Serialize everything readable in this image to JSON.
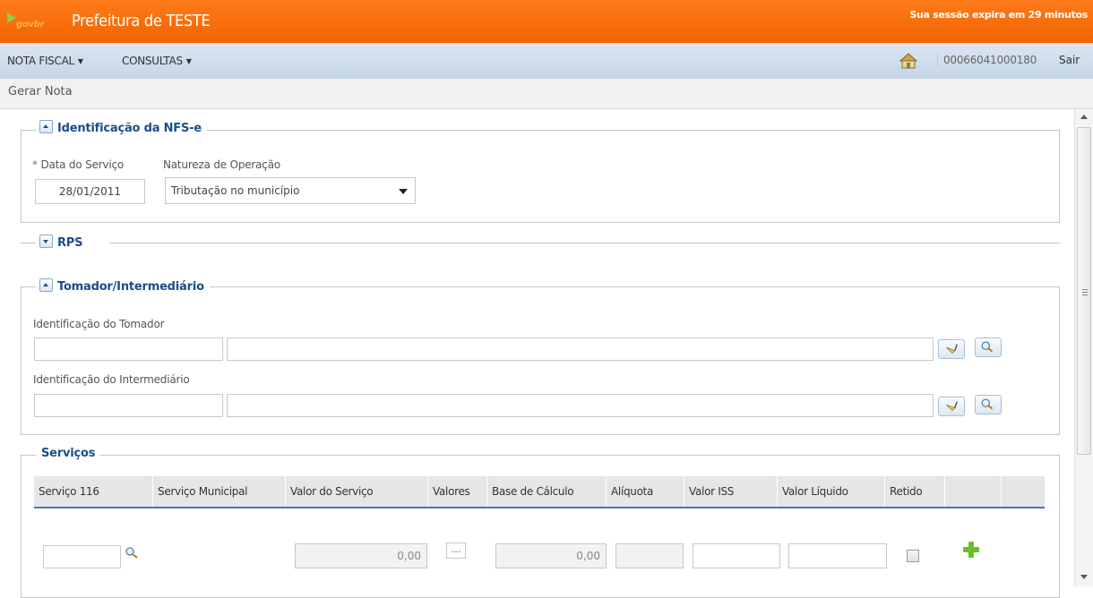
{
  "app": {
    "logo_text": "gov",
    "logo_text_suffix": "br",
    "title": "Prefeitura de TESTE",
    "session": "Sua sessão expira em 29 minutos"
  },
  "menu": {
    "items": [
      {
        "label": "NOTA FISCAL"
      },
      {
        "label": "CONSULTAS"
      }
    ],
    "user_id": "00066041000180",
    "logout": "Sair"
  },
  "breadcrumb": "Gerar Nota",
  "sections": {
    "identificacao": {
      "title": "Identificação da NFS-e",
      "data_label_required": "*",
      "data_label": "Data do Serviço",
      "data_value": "28/01/2011",
      "natureza_label": "Natureza de Operação",
      "natureza_value": "Tributação no município"
    },
    "rps": {
      "title": "RPS"
    },
    "tomador": {
      "title": "Tomador/Intermediário",
      "tomador_label": "Identificação do Tomador",
      "intermediario_label": "Identificação do Intermediário"
    },
    "servicos": {
      "title": "Serviços",
      "columns": [
        "Serviço 116",
        "Serviço Municipal",
        "Valor do Serviço",
        "Valores",
        "Base de Cálculo",
        "Alíquota",
        "Valor ISS",
        "Valor Líquido",
        "Retido",
        ""
      ],
      "row": {
        "valor_servico": "0,00",
        "valores_btn": "...",
        "base_calculo": "0,00"
      }
    }
  },
  "colors": {
    "topbar": "#f26400",
    "menubar": "#c5d5e6",
    "legend": "#1c4d8a",
    "table_accent": "#3b7bbf",
    "add_icon": "#6cbf2a"
  },
  "icons": [
    "home-icon",
    "eraser-icon",
    "search-icon",
    "plus-icon"
  ]
}
